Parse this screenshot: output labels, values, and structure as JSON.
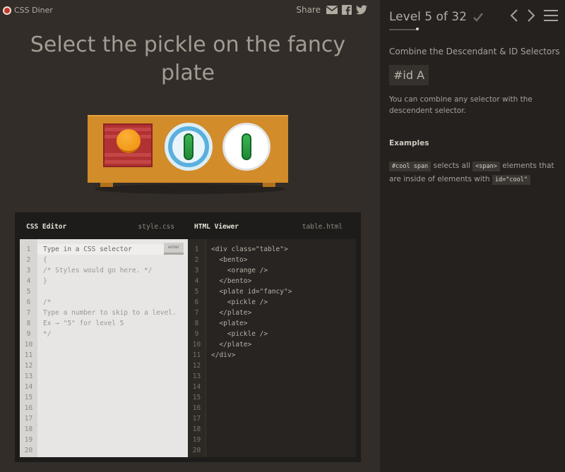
{
  "app": {
    "title": "CSS Diner"
  },
  "share": {
    "label": "Share"
  },
  "instruction": "Select the pickle on the fancy plate",
  "editor": {
    "css_pane_title": "CSS Editor",
    "css_file": "style.css",
    "html_pane_title": "HTML Viewer",
    "html_file": "table.html",
    "input_placeholder": "Type in a CSS selector",
    "enter_label": "enter",
    "css_lines": [
      "",
      "{",
      "/* Styles would go here. */",
      "}",
      "",
      "/*",
      "Type a number to skip to a level.",
      "Ex → \"5\" for level 5",
      "*/"
    ],
    "html_lines": [
      "<div class=\"table\">",
      "  <bento>",
      "    <orange />",
      "  </bento>",
      "  <plate id=\"fancy\">",
      "    <pickle />",
      "  </plate>",
      "  <plate>",
      "    <pickle />",
      "  </plate>",
      "</div>"
    ],
    "line_numbers": [
      "1",
      "2",
      "3",
      "4",
      "5",
      "6",
      "7",
      "8",
      "9",
      "10",
      "11",
      "12",
      "13",
      "14",
      "15",
      "16",
      "17",
      "18",
      "19",
      "20"
    ]
  },
  "level": {
    "label": "Level 5 of 32",
    "current": 5,
    "total": 32,
    "completed": false
  },
  "lesson": {
    "subtitle": "Combine the Descendant & ID Selectors",
    "selector": "#id A",
    "description": "You can combine any selector with the descendent selector.",
    "examples_title": "Examples",
    "example": {
      "code1": "#cool span",
      "text1": " selects all ",
      "code2": "<span>",
      "text2": " elements that are inside of elements with ",
      "code3": "id=\"cool\""
    }
  },
  "colors": {
    "table": "#d28c2a",
    "bento": "#b03232",
    "orange": "#f5a020",
    "pickle": "#2a9d40",
    "fancy_plate": "#5bb0dd",
    "accent": "#c0392b"
  },
  "icons": {
    "logo": "logo-dot-icon",
    "email": "email-icon",
    "facebook": "facebook-icon",
    "twitter": "twitter-icon",
    "check": "checkmark-icon",
    "prev": "chevron-left-icon",
    "next": "chevron-right-icon",
    "menu": "hamburger-menu-icon"
  }
}
